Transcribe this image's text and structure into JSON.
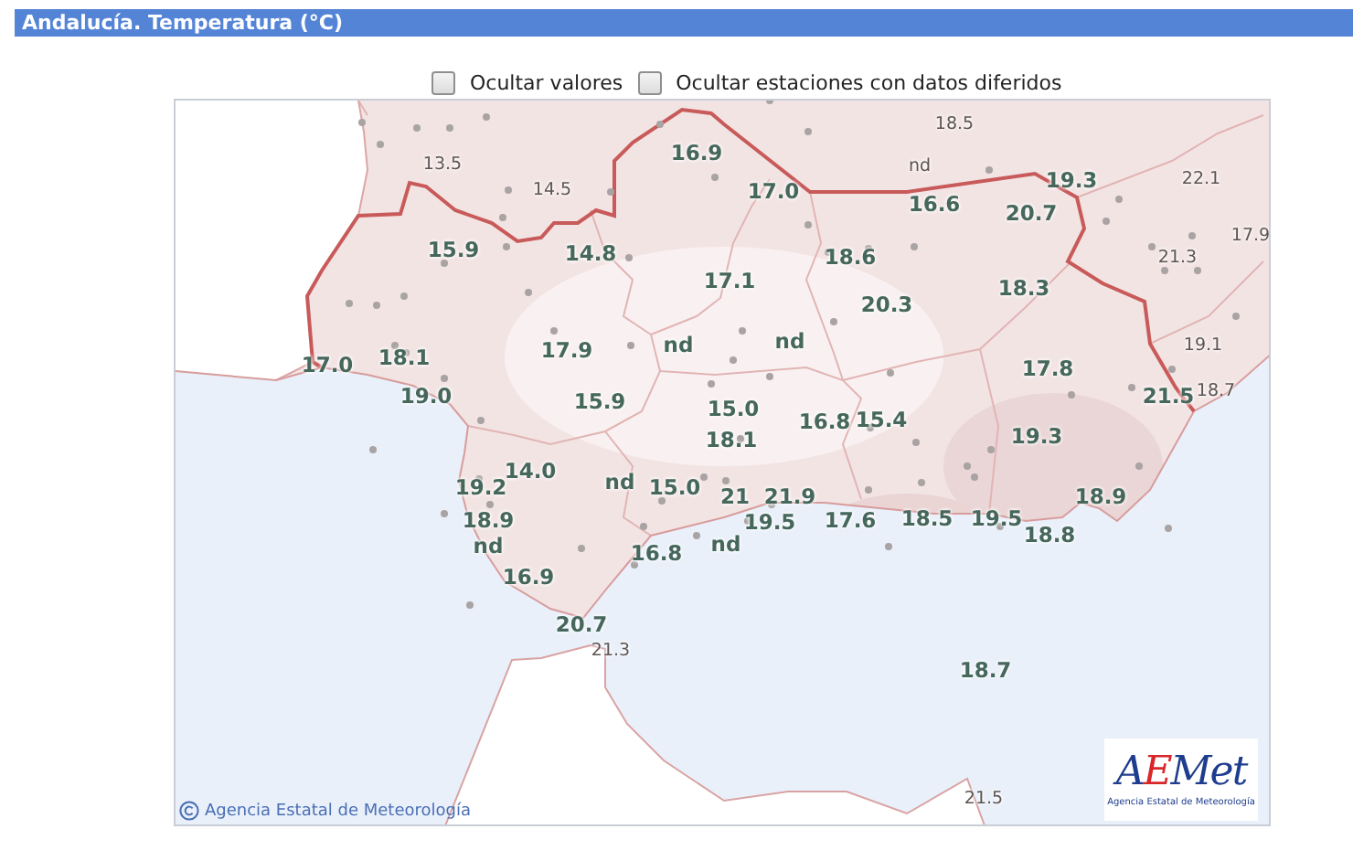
{
  "header": {
    "title": "Andalucía. Temperatura (°C)"
  },
  "options": [
    {
      "label": "Ocultar valores",
      "checked": false
    },
    {
      "label": "Ocultar estaciones con datos diferidos",
      "checked": false
    }
  ],
  "map": {
    "values": [
      {
        "text": "18.5",
        "kind": "outside"
      },
      {
        "text": "13.5",
        "kind": "outside"
      },
      {
        "text": "16.9",
        "kind": "station"
      },
      {
        "text": "nd",
        "kind": "outside"
      },
      {
        "text": "14.5",
        "kind": "outside"
      },
      {
        "text": "17.0",
        "kind": "station"
      },
      {
        "text": "19.3",
        "kind": "station"
      },
      {
        "text": "22.1",
        "kind": "outside"
      },
      {
        "text": "16.6",
        "kind": "station"
      },
      {
        "text": "20.7",
        "kind": "station"
      },
      {
        "text": "15.9",
        "kind": "station"
      },
      {
        "text": "14.8",
        "kind": "station"
      },
      {
        "text": "18.6",
        "kind": "station"
      },
      {
        "text": "21.3",
        "kind": "outside"
      },
      {
        "text": "17.9",
        "kind": "outside"
      },
      {
        "text": "17.1",
        "kind": "station"
      },
      {
        "text": "20.3",
        "kind": "station"
      },
      {
        "text": "18.3",
        "kind": "station"
      },
      {
        "text": "17.0",
        "kind": "station"
      },
      {
        "text": "18.1",
        "kind": "station"
      },
      {
        "text": "17.9",
        "kind": "station"
      },
      {
        "text": "nd",
        "kind": "station"
      },
      {
        "text": "nd",
        "kind": "station"
      },
      {
        "text": "17.8",
        "kind": "station"
      },
      {
        "text": "19.1",
        "kind": "outside"
      },
      {
        "text": "19.0",
        "kind": "station"
      },
      {
        "text": "15.9",
        "kind": "station"
      },
      {
        "text": "15.0",
        "kind": "station"
      },
      {
        "text": "21.5",
        "kind": "station"
      },
      {
        "text": "18.7",
        "kind": "outside"
      },
      {
        "text": "18.1",
        "kind": "station"
      },
      {
        "text": "16.8",
        "kind": "station"
      },
      {
        "text": "15.4",
        "kind": "station"
      },
      {
        "text": "19.3",
        "kind": "station"
      },
      {
        "text": "19.2",
        "kind": "station"
      },
      {
        "text": "14.0",
        "kind": "station"
      },
      {
        "text": "nd",
        "kind": "station"
      },
      {
        "text": "15.0",
        "kind": "station"
      },
      {
        "text": "21",
        "kind": "station"
      },
      {
        "text": "21.9",
        "kind": "station"
      },
      {
        "text": "18.9",
        "kind": "station"
      },
      {
        "text": "18.9",
        "kind": "station"
      },
      {
        "text": "19.5",
        "kind": "station"
      },
      {
        "text": "17.6",
        "kind": "station"
      },
      {
        "text": "18.5",
        "kind": "station"
      },
      {
        "text": "19.5",
        "kind": "station"
      },
      {
        "text": "nd",
        "kind": "station"
      },
      {
        "text": "16.8",
        "kind": "station"
      },
      {
        "text": "nd",
        "kind": "station"
      },
      {
        "text": "18.8",
        "kind": "station"
      },
      {
        "text": "16.9",
        "kind": "station"
      },
      {
        "text": "20.7",
        "kind": "station"
      },
      {
        "text": "21.3",
        "kind": "outside"
      },
      {
        "text": "18.7",
        "kind": "station"
      },
      {
        "text": "21.5",
        "kind": "outside"
      }
    ],
    "credit": "Agencia Estatal de Meteorología",
    "logo": {
      "wordmark": "AEMet",
      "caption": "Agencia Estatal de Meteorología"
    }
  }
}
